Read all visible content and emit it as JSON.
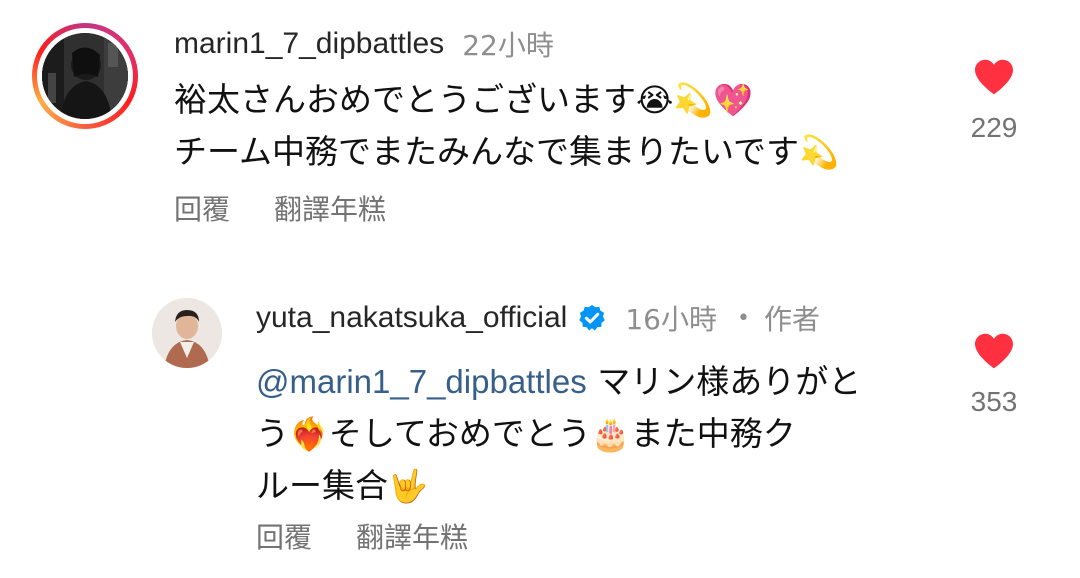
{
  "comments": [
    {
      "username": "marin1_7_dipbattles",
      "time": "22小時",
      "lines": [
        {
          "text": "裕太さんおめでとうございます",
          "emoji": "😭💫💖"
        },
        {
          "text": "チーム中務でまたみんなで集まりたいです",
          "emoji": "💫"
        }
      ],
      "actions": {
        "reply": "回覆",
        "translate": "翻譯年糕"
      },
      "likes": "229",
      "has_story_ring": true
    },
    {
      "username": "yuta_nakatsuka_official",
      "verified": true,
      "time": "16小時",
      "separator": "•",
      "author_label": "作者",
      "mention": "@marin1_7_dipbattles",
      "text_segments": {
        "a": " マリン様ありがと",
        "b": "う",
        "b_emoji": "❤️‍🔥",
        "c": "そしておめでとう",
        "c_emoji": "🎂",
        "d": "また中務ク",
        "e": "ルー集合",
        "e_emoji": "🤟"
      },
      "actions": {
        "reply": "回覆",
        "translate": "翻譯年糕"
      },
      "likes": "353"
    }
  ],
  "colors": {
    "heart": "#ff3040",
    "mention": "#365f8a",
    "verified": "#0095f6",
    "muted": "#8e8e8e"
  }
}
